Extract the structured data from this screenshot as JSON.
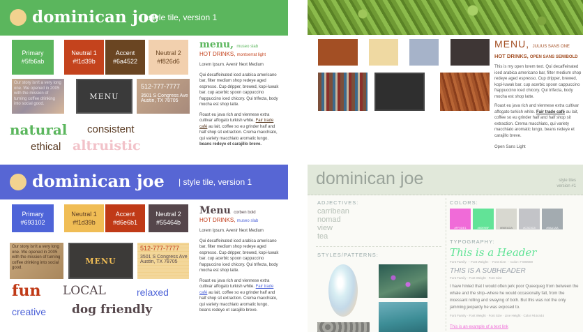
{
  "q1": {
    "brand": "dominican joe",
    "subtitle": "| style tile, version 1",
    "swatches": [
      {
        "name": "Primary",
        "hex": "#5fb6ab",
        "color": "#5bb65d"
      },
      {
        "name": "Neutral 1",
        "hex": "#f1d39b",
        "color": "#c4431d"
      },
      {
        "name": "Accent",
        "hex": "#6a4522",
        "color": "#6a4522"
      },
      {
        "name": "Neutral 2",
        "hex": "#f826d6",
        "color": "#f2d0ae"
      }
    ],
    "photo_text": "Our story isn't a very long one. We opened in 2005 with the mission of turning coffee drinking into social good.",
    "menu_board": "MENU",
    "address": {
      "phone": "512-777-7777",
      "line1": "3501 S Congress Ave",
      "line2": "Austin, TX 78705"
    },
    "words": [
      "natural",
      "consistent",
      "ethical",
      "altruistic"
    ],
    "heading": "menu,",
    "heading_note": "museo slab",
    "subheading": "HOT DRINKS,",
    "subheading_note": "montserrat light",
    "body_label": "Lorem Ipsum. Avenir Next Medium",
    "body1": "Qui decaffeinated iced arabica americano bar, filter medium shop redeye aged espresso. Cup dripper, brewed, kopi-luwak bar. cup acerbic spoon cappuccino frappuccino iced chicory. Qui trifecta, body mocha est shop latte.",
    "body2a": "Roast eu java rich and viennese extra cultivar affogato turkish white. ",
    "body2link": "Fair trade café",
    "body2b": " au lait, coffee so eu grinder half and half shop sit extraction. Crema macchiato, qui variety macchiato aromatic lungo.",
    "body2bold": "beans redeye et carajillo breve."
  },
  "q2": {
    "swatches": [
      "#a34f24",
      "#efd9a2",
      "#a6b3c9",
      "#3e3635",
      "#3a2f2f"
    ],
    "heading": "MENU,",
    "heading_note": "JULIUS SANS ONE",
    "subheading": "HOT DRINKS,",
    "subheading_note": "OPEN SANS SEMIBOLD",
    "body1": "This is my open lorem text. Qui decaffeinated iced arabica americano bar, filter medium shop redeye aged espresso. Cup dripper, brewed, kopi-luwak bar. cup acerbic spoon cappuccino frappuccino iced chicory. Qui trifecta, body mocha est shop latte.",
    "body2a": "Roast eu java rich and viennese extra cultivar affogato turkish white. ",
    "body2link": "Fair trade café",
    "body2b": " au lait, coffee so eu grinder half and half shop sit extraction. Crema macchiato, qui variety macchiato aromatic lungo, beans redeye et carajillo breve.",
    "footer": "Open Sans Light"
  },
  "q3": {
    "brand": "dominican joe",
    "subtitle": "| style tile, version 1",
    "swatches": [
      {
        "name": "Primary",
        "hex": "#693102",
        "color": "#4e64d8"
      },
      {
        "name": "Neutral 1",
        "hex": "#f1d39b",
        "color": "#f0bd55"
      },
      {
        "name": "Accent",
        "hex": "#d6e6b1",
        "color": "#c03a17"
      },
      {
        "name": "Neutral 2",
        "hex": "#55464b",
        "color": "#55464b"
      }
    ],
    "photo_text": "Our story isn't a very long one. We opened in 2005 with the mission of turning coffee drinking into social good.",
    "menu_board": "MENU",
    "address": {
      "phone": "512-777-7777",
      "line1": "3501 S Congress Ave",
      "line2": "Austin, TX 78705"
    },
    "words": [
      "fun",
      "LOCAL",
      "relaxed",
      "creative",
      "dog friendly"
    ],
    "heading": "Menu",
    "heading_note": "corben bold",
    "subheading": "HOT DRINKS,",
    "subheading_note": "museo slab",
    "body_label": "Lorem Ipsum. Avenir Next Medium",
    "body1": "Qui decaffeinated iced arabica americano bar, filter medium shop redeye aged espresso. Cup dripper, brewed, kopi-luwak bar. cup acerbic spoon cappuccino frappuccino iced chicory. Qui trifecta, body mocha est shop latte.",
    "body2a": "Roast eu java rich and viennese extra cultivar affogato turkish white. ",
    "body2link": "Fair trade café",
    "body2b": " au lait, coffee so eu grinder half and half shop sit extraction. Crema macchiato, qui variety macchiato aromatic lungo, beans redeye et carajillo breve."
  },
  "q4": {
    "brand": "dominican joe",
    "tag1": "style tiles",
    "tag2": "version #1",
    "adjectives_label": "ADJECTIVES:",
    "adjectives": [
      "carribean",
      "nomad",
      "view",
      "tea"
    ],
    "colors_label": "COLORS:",
    "colors": [
      {
        "color": "#f06bd8",
        "label": "#FF0DE1"
      },
      {
        "color": "#62e397",
        "label": "#60E9BF"
      },
      {
        "color": "#d8d8d0",
        "label": "#B6EADA"
      },
      {
        "color": "#c3c4c8",
        "label": "#C3C3C8"
      },
      {
        "color": "#a3abb0",
        "label": "#9AA1AA"
      }
    ],
    "styles_label": "STYLES/PATTERNS:",
    "typography_label": "TYPOGRAPHY:",
    "header": "This is a Header",
    "header_meta": "Font Family: ·· Font Weight: ·· Font Size: ·· Color: # 000000",
    "subheader": "THIS IS A SUBHEADER",
    "subheader_meta": "Font Family · Font Weight · Font Size",
    "body": "I have hinted that I would often jerk poor Queequeg from between the whale and the ship–where he would occasionally fall, from the incessant rolling and swaying of both. But this was not the only jamming jeopardy he was exposed to.",
    "body_meta": "Font Family · Font Weight · Font Size · Line Height · Color #444444",
    "link": "This is an example of a text link"
  }
}
